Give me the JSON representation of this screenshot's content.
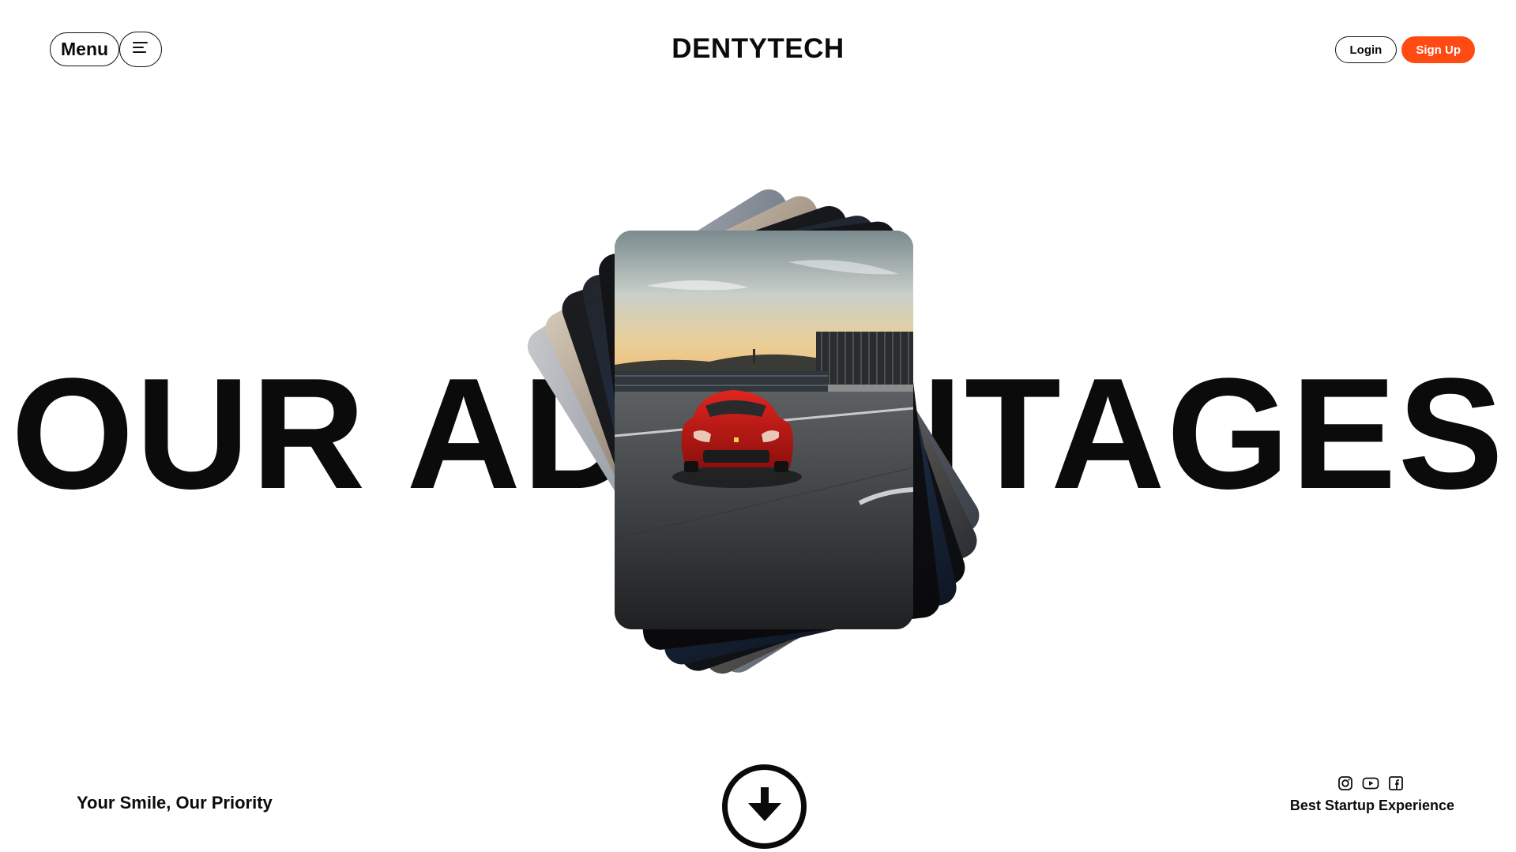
{
  "header": {
    "menu_label": "Menu",
    "menu_icon": "hamburger-menu-icon",
    "brand": "DENTYTECH",
    "login_label": "Login",
    "signup_label": "Sign Up"
  },
  "hero": {
    "title": "OUR ADVANTAGES",
    "gallery": {
      "front_image": "red-sports-car-parking-deck",
      "stacked_cards_behind": 5
    }
  },
  "footer": {
    "tagline": "Your Smile, Our Priority",
    "scroll_icon": "arrow-down-circle-icon",
    "social_icons": [
      "instagram-icon",
      "youtube-icon",
      "facebook-icon"
    ],
    "experience_text": "Best Startup Experience"
  },
  "colors": {
    "accent": "#ff4a12",
    "text": "#0b0b0b",
    "background": "#ffffff"
  }
}
